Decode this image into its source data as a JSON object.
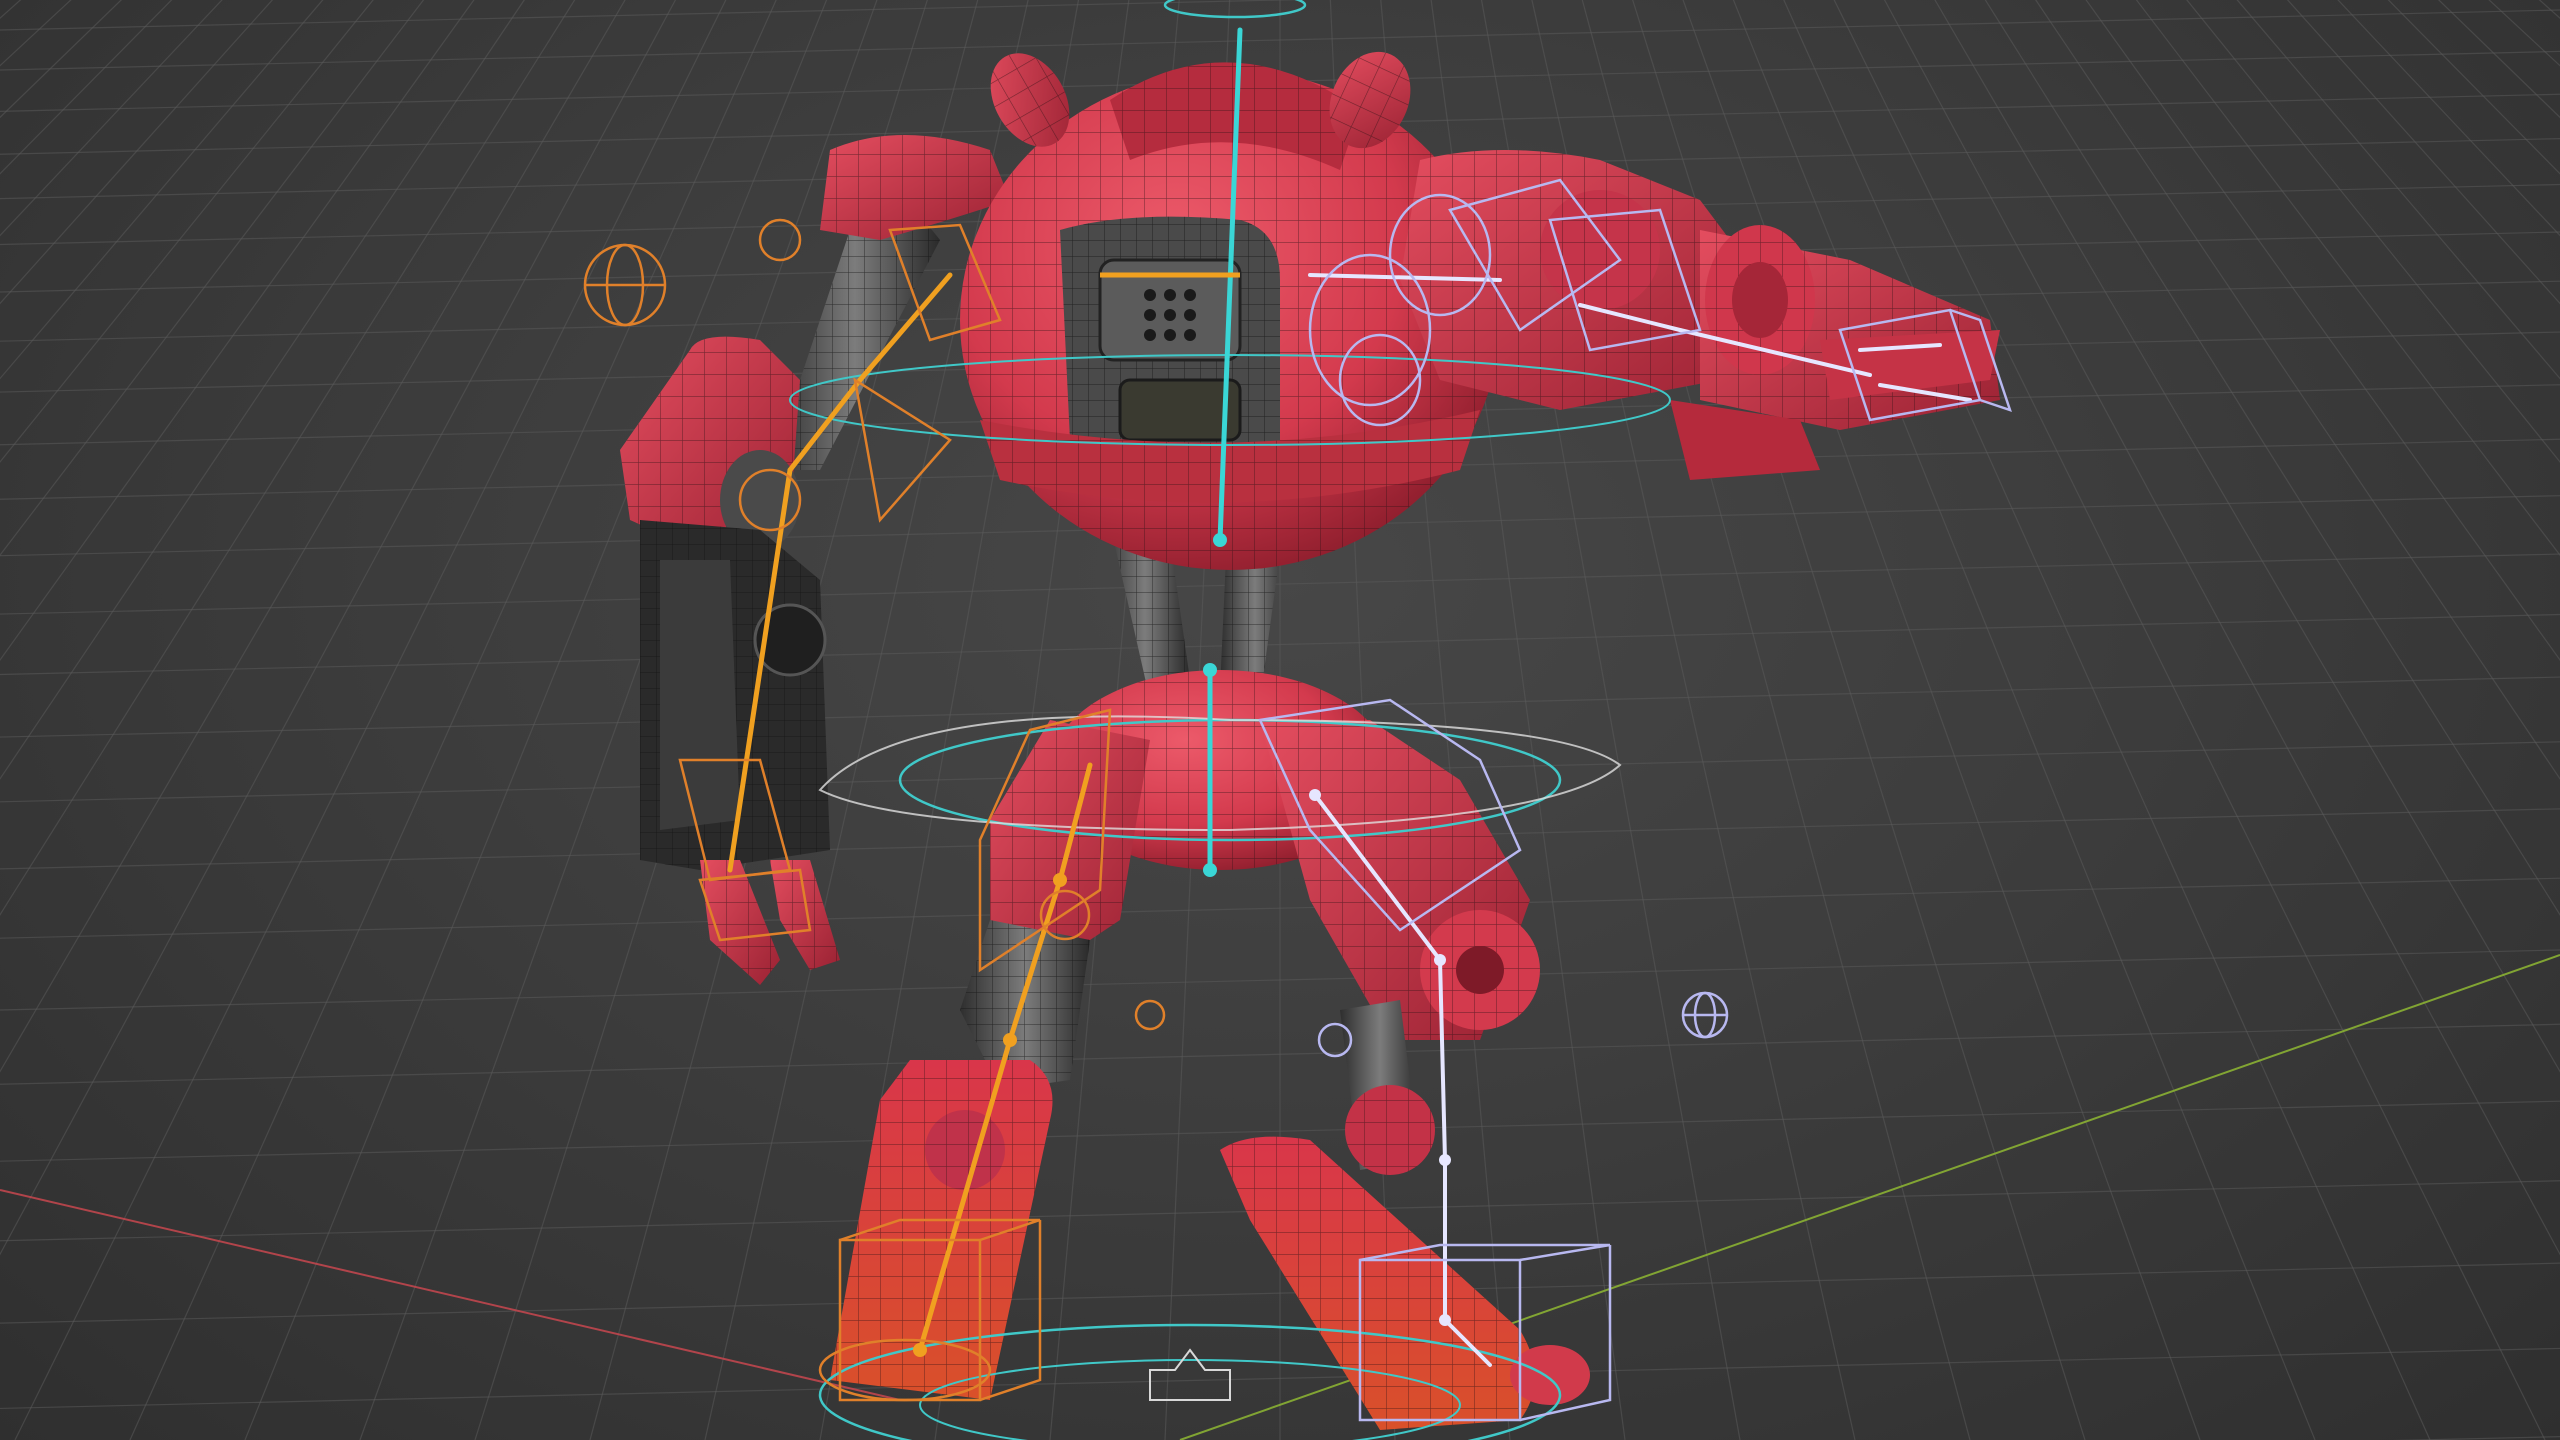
{
  "viewport": {
    "background": "#3a3a3a",
    "grid_color": "#5a5a5a",
    "x_axis_color": "#c8474f",
    "y_axis_color": "#8fb833"
  },
  "model": {
    "body_color": "#d93a4e",
    "body_shadow": "#8a1c2a",
    "metal_color": "#5e5e5e",
    "metal_dark": "#2a2a2a",
    "wire_color": "#1b1b1b"
  },
  "rig": {
    "left_chain_color": "#f0a020",
    "center_chain_color": "#3ad6d6",
    "right_chain_color": "#e6e6ff",
    "control_orange": "#e0802a",
    "control_cyan": "#40c8c8",
    "control_lavender": "#b8b8f0"
  }
}
